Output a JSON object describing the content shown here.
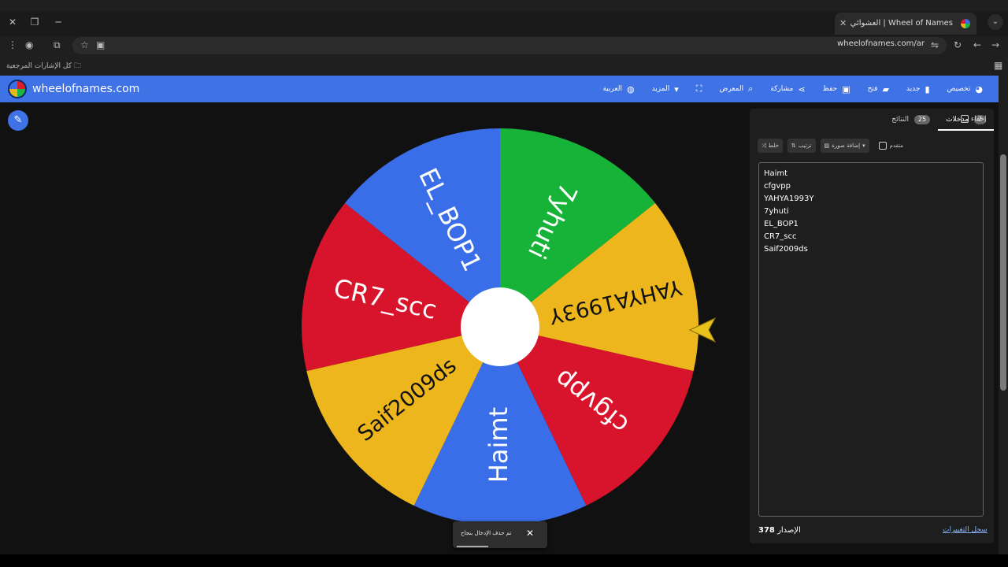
{
  "browser": {
    "tab_title": "Wheel of Names | العشوائي",
    "url": "wheelofnames.com/ar",
    "bookmarks_label": "كل الإشارات المرجعية"
  },
  "header": {
    "site_title": "wheelofnames.com",
    "menu": [
      {
        "label": "تخصيص",
        "icon": "palette-icon"
      },
      {
        "label": "جديد",
        "icon": "file-icon"
      },
      {
        "label": "فتح",
        "icon": "folder-icon"
      },
      {
        "label": "حفظ",
        "icon": "save-icon"
      },
      {
        "label": "مشاركة",
        "icon": "share-icon"
      },
      {
        "label": "المعرض",
        "icon": "search-icon"
      },
      {
        "label": "",
        "icon": "fullscreen-icon"
      },
      {
        "label": "المزيد",
        "icon": "chevron-down-icon"
      },
      {
        "label": "العربية",
        "icon": "globe-icon"
      }
    ]
  },
  "wheel": {
    "segments": [
      {
        "label": "7yhuti",
        "color": "#17b338"
      },
      {
        "label": "YAHYA1993Y",
        "color": "#ecb61c"
      },
      {
        "label": "cfgvpp",
        "color": "#d7142b"
      },
      {
        "label": "Haimt",
        "color": "#3a6ee8"
      },
      {
        "label": "Saif2009ds",
        "color": "#ecb61c"
      },
      {
        "label": "CR7_scc",
        "color": "#d7142b"
      },
      {
        "label": "EL_BOP1",
        "color": "#3a6ee8"
      }
    ]
  },
  "panel": {
    "tab_entries_label": "مدخلات",
    "tab_entries_count": "7",
    "tab_results_label": "النتائج",
    "tab_results_count": "25",
    "hide_label": "إخفاء",
    "shuffle_label": "خلط",
    "sort_label": "ترتيب",
    "add_image_label": "إضافة صورة",
    "advanced_label": "متقدم",
    "entries_text": "Haimt\ncfgvpp\nYAHYA1993Y\n7yhuti\nEL_BOP1\nCR7_scc\nSaif2009ds",
    "version_label": "الإصدار",
    "version_number": "378",
    "changelog_label": "سجل التغييرات"
  },
  "toast": {
    "message": "تم حذف الإدخال بنجاح"
  }
}
